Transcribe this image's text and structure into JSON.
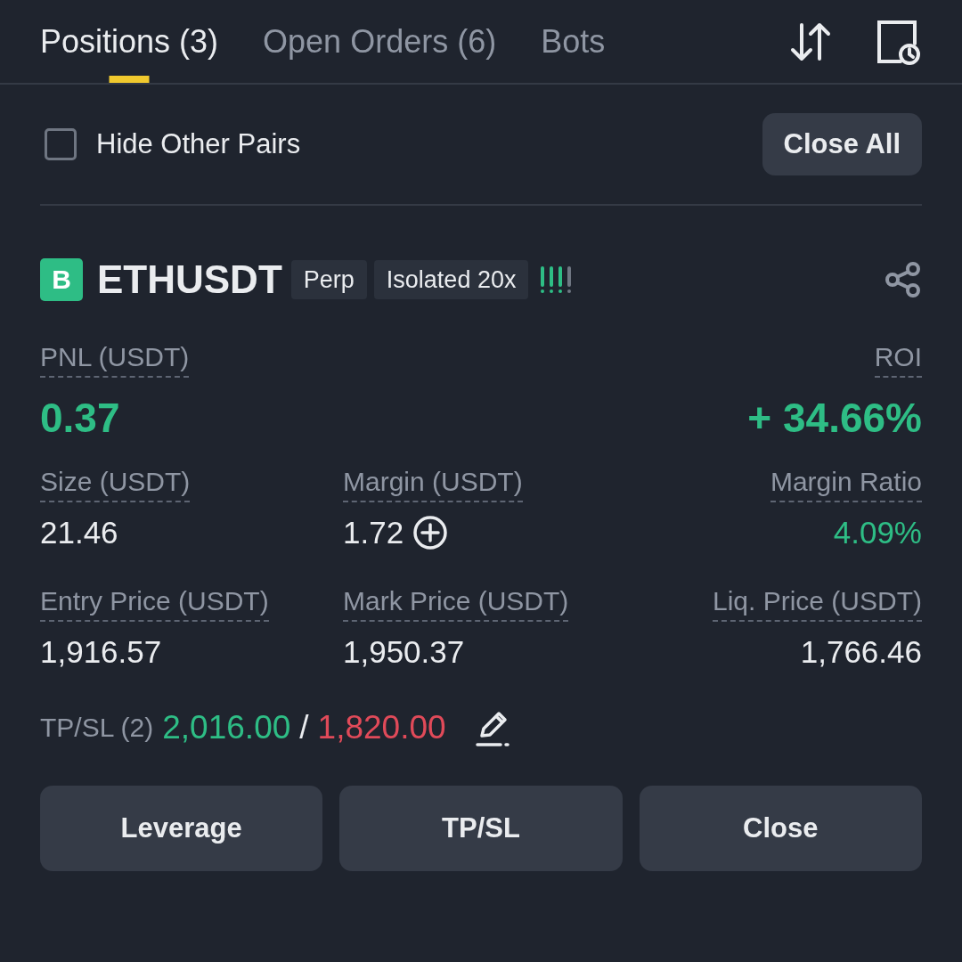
{
  "tabs": [
    {
      "label": "Positions (3)",
      "selected": true
    },
    {
      "label": "Open Orders (6)",
      "selected": false
    },
    {
      "label": "Bots",
      "selected": false
    }
  ],
  "filter": {
    "label": "Hide Other Pairs",
    "checked": false
  },
  "close_all_button": "Close All",
  "position": {
    "side": "B",
    "symbol": "ETHUSDT",
    "tags": [
      "Perp",
      "Isolated 20x"
    ],
    "risk": {
      "level": 0.75
    },
    "pnl": {
      "label": "PNL (USDT)",
      "value": "0.37"
    },
    "roi": {
      "label": "ROI",
      "value": "+ 34.66%"
    },
    "fields": [
      {
        "label": "Size (USDT)",
        "value": "21.46",
        "kind": "plain"
      },
      {
        "label": "Margin (USDT)",
        "value": "1.72",
        "kind": "add"
      },
      {
        "label": "Margin Ratio",
        "value": "4.09%",
        "kind": "positive"
      },
      {
        "label": "Entry Price (USDT)",
        "value": "1,916.57",
        "kind": "plain"
      },
      {
        "label": "Mark Price (USDT)",
        "value": "1,950.37",
        "kind": "plain"
      },
      {
        "label": "Liq. Price (USDT)",
        "value": "1,766.46",
        "kind": "plain"
      }
    ],
    "tpsl": {
      "label": "TP/SL (2)",
      "take_profit": "2,016.00",
      "separator": "/",
      "stop_loss": "1,820.00"
    },
    "buttons": [
      "Leverage",
      "TP/SL",
      "Close"
    ]
  }
}
